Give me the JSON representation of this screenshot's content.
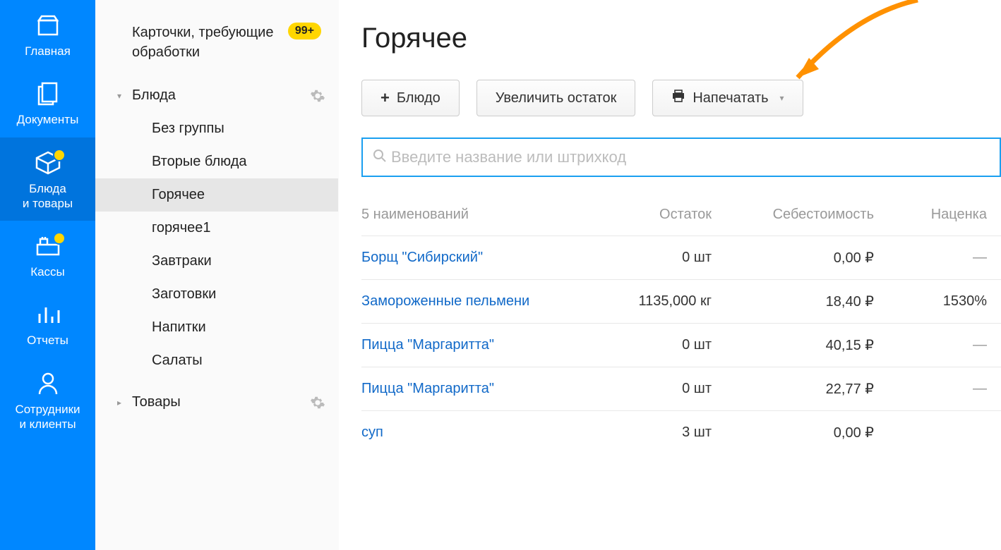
{
  "rail": {
    "items": [
      {
        "key": "home",
        "label": "Главная"
      },
      {
        "key": "docs",
        "label": "Документы"
      },
      {
        "key": "dishes",
        "label": "Блюда\nи товары",
        "alert": true,
        "active": true
      },
      {
        "key": "cash",
        "label": "Кассы",
        "alert": true
      },
      {
        "key": "reports",
        "label": "Отчеты"
      },
      {
        "key": "staff",
        "label": "Сотрудники\nи клиенты"
      }
    ]
  },
  "sidebar": {
    "pending": {
      "label": "Карточки, требующие обработки",
      "badge": "99+"
    },
    "groups": [
      {
        "label": "Блюда",
        "expanded": true,
        "children": [
          {
            "label": "Без группы"
          },
          {
            "label": "Вторые блюда"
          },
          {
            "label": "Горячее",
            "selected": true
          },
          {
            "label": "горячее1"
          },
          {
            "label": "Завтраки"
          },
          {
            "label": "Заготовки"
          },
          {
            "label": "Напитки"
          },
          {
            "label": "Салаты"
          }
        ]
      },
      {
        "label": "Товары",
        "expanded": false
      }
    ]
  },
  "main": {
    "title": "Горячее",
    "buttons": {
      "add": "Блюдо",
      "increase": "Увеличить остаток",
      "print": "Напечатать"
    },
    "search": {
      "placeholder": "Введите название или штрихкод"
    },
    "table": {
      "count_label": "5 наименований",
      "headers": {
        "stock": "Остаток",
        "cost": "Себестоимость",
        "markup": "Наценка"
      },
      "rows": [
        {
          "name": "Борщ \"Сибирский\"",
          "stock": "0 шт",
          "cost": "0,00 ₽",
          "markup": "—"
        },
        {
          "name": "Замороженные пельмени",
          "stock": "1135,000 кг",
          "cost": "18,40 ₽",
          "markup": "1530%"
        },
        {
          "name": "Пицца \"Маргаритта\"",
          "stock": "0 шт",
          "cost": "40,15 ₽",
          "markup": "—"
        },
        {
          "name": "Пицца \"Маргаритта\"",
          "stock": "0 шт",
          "cost": "22,77 ₽",
          "markup": "—"
        },
        {
          "name": "суп",
          "stock": "3 шт",
          "cost": "0,00 ₽",
          "markup": ""
        }
      ]
    }
  }
}
